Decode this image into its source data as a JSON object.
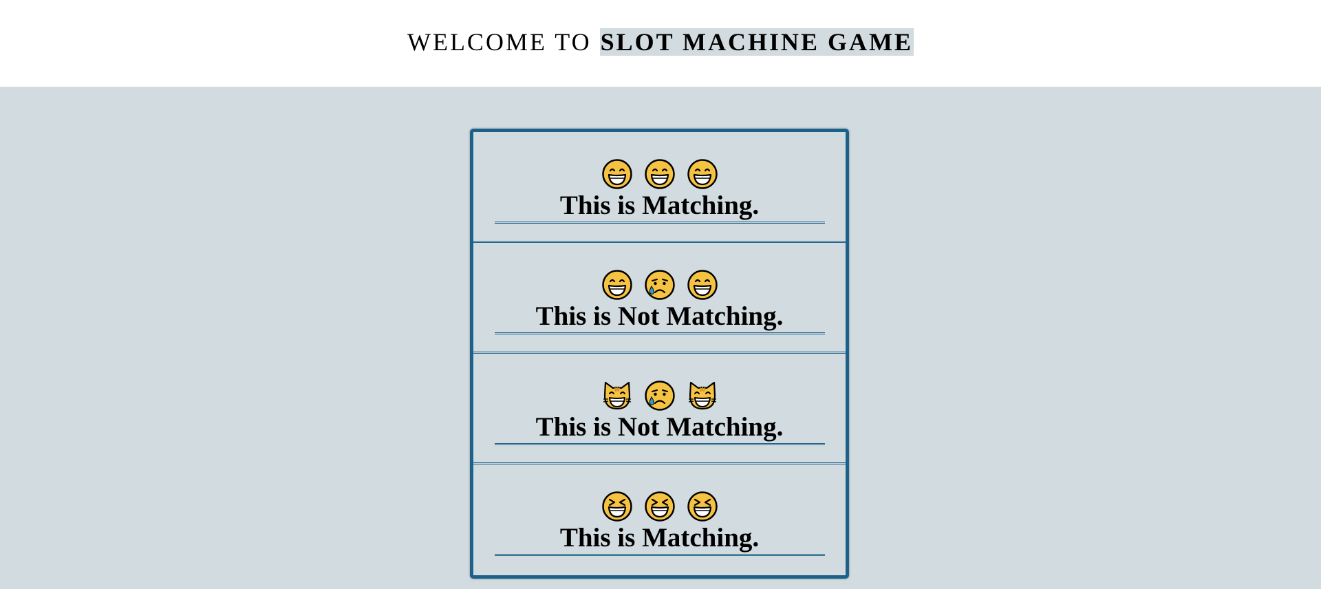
{
  "header": {
    "title_prefix": "WELCOME TO ",
    "title_highlight": "SLOT MACHINE GAME"
  },
  "colors": {
    "background": "#d2dbdf",
    "border": "#1b6189",
    "face_fill": "#f5c242",
    "tear": "#2a9fd6"
  },
  "rows": [
    {
      "emojis": [
        "grinning-face-icon",
        "grinning-face-icon",
        "grinning-face-icon"
      ],
      "result": "This is Matching."
    },
    {
      "emojis": [
        "grinning-face-icon",
        "crying-face-icon",
        "grinning-face-icon"
      ],
      "result": "This is Not Matching."
    },
    {
      "emojis": [
        "grinning-cat-icon",
        "crying-face-icon",
        "grinning-cat-icon"
      ],
      "result": "This is Not Matching."
    },
    {
      "emojis": [
        "squinting-laughing-face-icon",
        "squinting-laughing-face-icon",
        "squinting-laughing-face-icon"
      ],
      "result": "This is Matching."
    }
  ]
}
